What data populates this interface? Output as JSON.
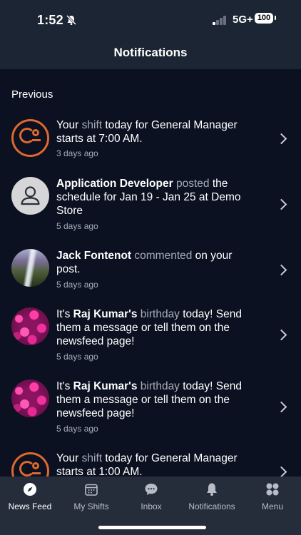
{
  "status": {
    "time": "1:52",
    "network": "5G+",
    "battery": "100"
  },
  "header": {
    "title": "Notifications"
  },
  "section": {
    "label": "Previous"
  },
  "notifications": [
    {
      "pre": "Your ",
      "muted": "shift",
      "post": " today for General Manager starts at 7:00 AM.",
      "ago": "3 days ago"
    },
    {
      "name": "Application Developer",
      "muted": " posted",
      "post": " the schedule for Jan 19 - Jan 25 at Demo Store",
      "ago": "5 days ago"
    },
    {
      "name": "Jack Fontenot",
      "muted": " commented",
      "post": " on your post.",
      "ago": "5 days ago"
    },
    {
      "pre": "It's ",
      "name": "Raj Kumar's",
      "muted": " birthday",
      "post": " today! Send them a message or tell them on the newsfeed page!",
      "ago": "5 days ago"
    },
    {
      "pre": "It's ",
      "name": "Raj Kumar's",
      "muted": " birthday",
      "post": " today! Send them a message or tell them on the newsfeed page!",
      "ago": "5 days ago"
    },
    {
      "pre": "Your ",
      "muted": "shift",
      "post": " today for General Manager starts at 1:00 AM."
    }
  ],
  "tabs": [
    {
      "label": "News Feed",
      "icon": "compass-icon"
    },
    {
      "label": "My Shifts",
      "icon": "calendar-icon"
    },
    {
      "label": "Inbox",
      "icon": "chat-bubble-icon"
    },
    {
      "label": "Notifications",
      "icon": "bell-icon"
    },
    {
      "label": "Menu",
      "icon": "grid-dots-icon"
    }
  ],
  "colors": {
    "brand": "#e0682e",
    "background": "#0b1120",
    "header": "#1c2533",
    "tabbar": "#252d3b"
  }
}
